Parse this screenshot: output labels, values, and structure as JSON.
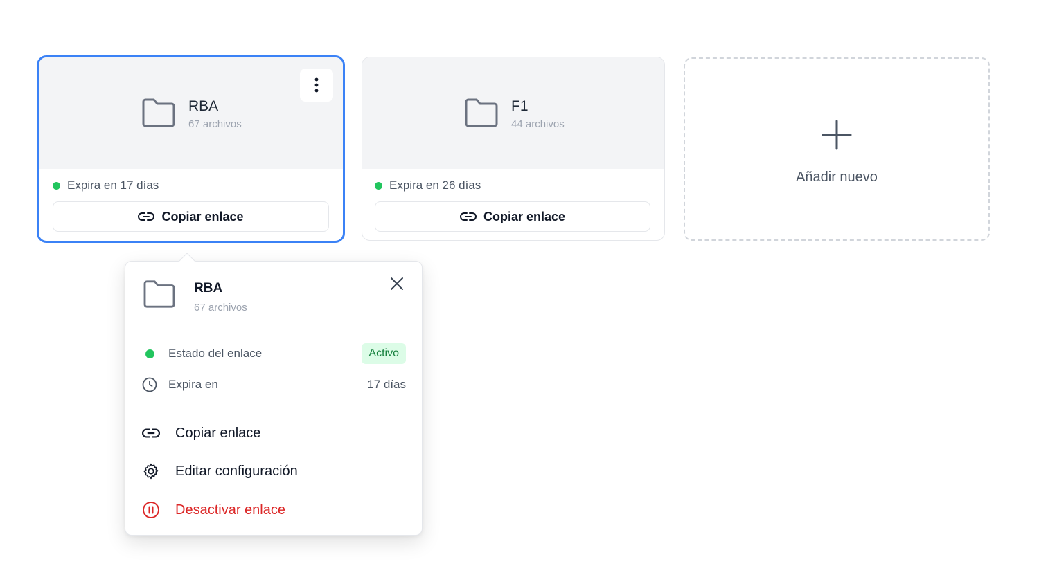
{
  "cards": [
    {
      "name": "RBA",
      "count": "67 archivos",
      "expiry": "Expira en 17 días",
      "copy_label": "Copiar enlace",
      "status_color": "#22c55e"
    },
    {
      "name": "F1",
      "count": "44 archivos",
      "expiry": "Expira en 26 días",
      "copy_label": "Copiar enlace",
      "status_color": "#22c55e"
    }
  ],
  "add_card": {
    "label": "Añadir nuevo"
  },
  "popover": {
    "name": "RBA",
    "count": "67 archivos",
    "status_label": "Estado del enlace",
    "status_value": "Activo",
    "expires_label": "Expira en",
    "expires_value": "17 días",
    "actions": [
      {
        "label": "Copiar enlace",
        "icon": "link-icon"
      },
      {
        "label": "Editar configuración",
        "icon": "gear-icon"
      },
      {
        "label": "Desactivar enlace",
        "icon": "pause-circle-icon"
      }
    ]
  },
  "colors": {
    "accent": "#3b82f6",
    "active": "#22c55e",
    "danger": "#dc2626"
  }
}
